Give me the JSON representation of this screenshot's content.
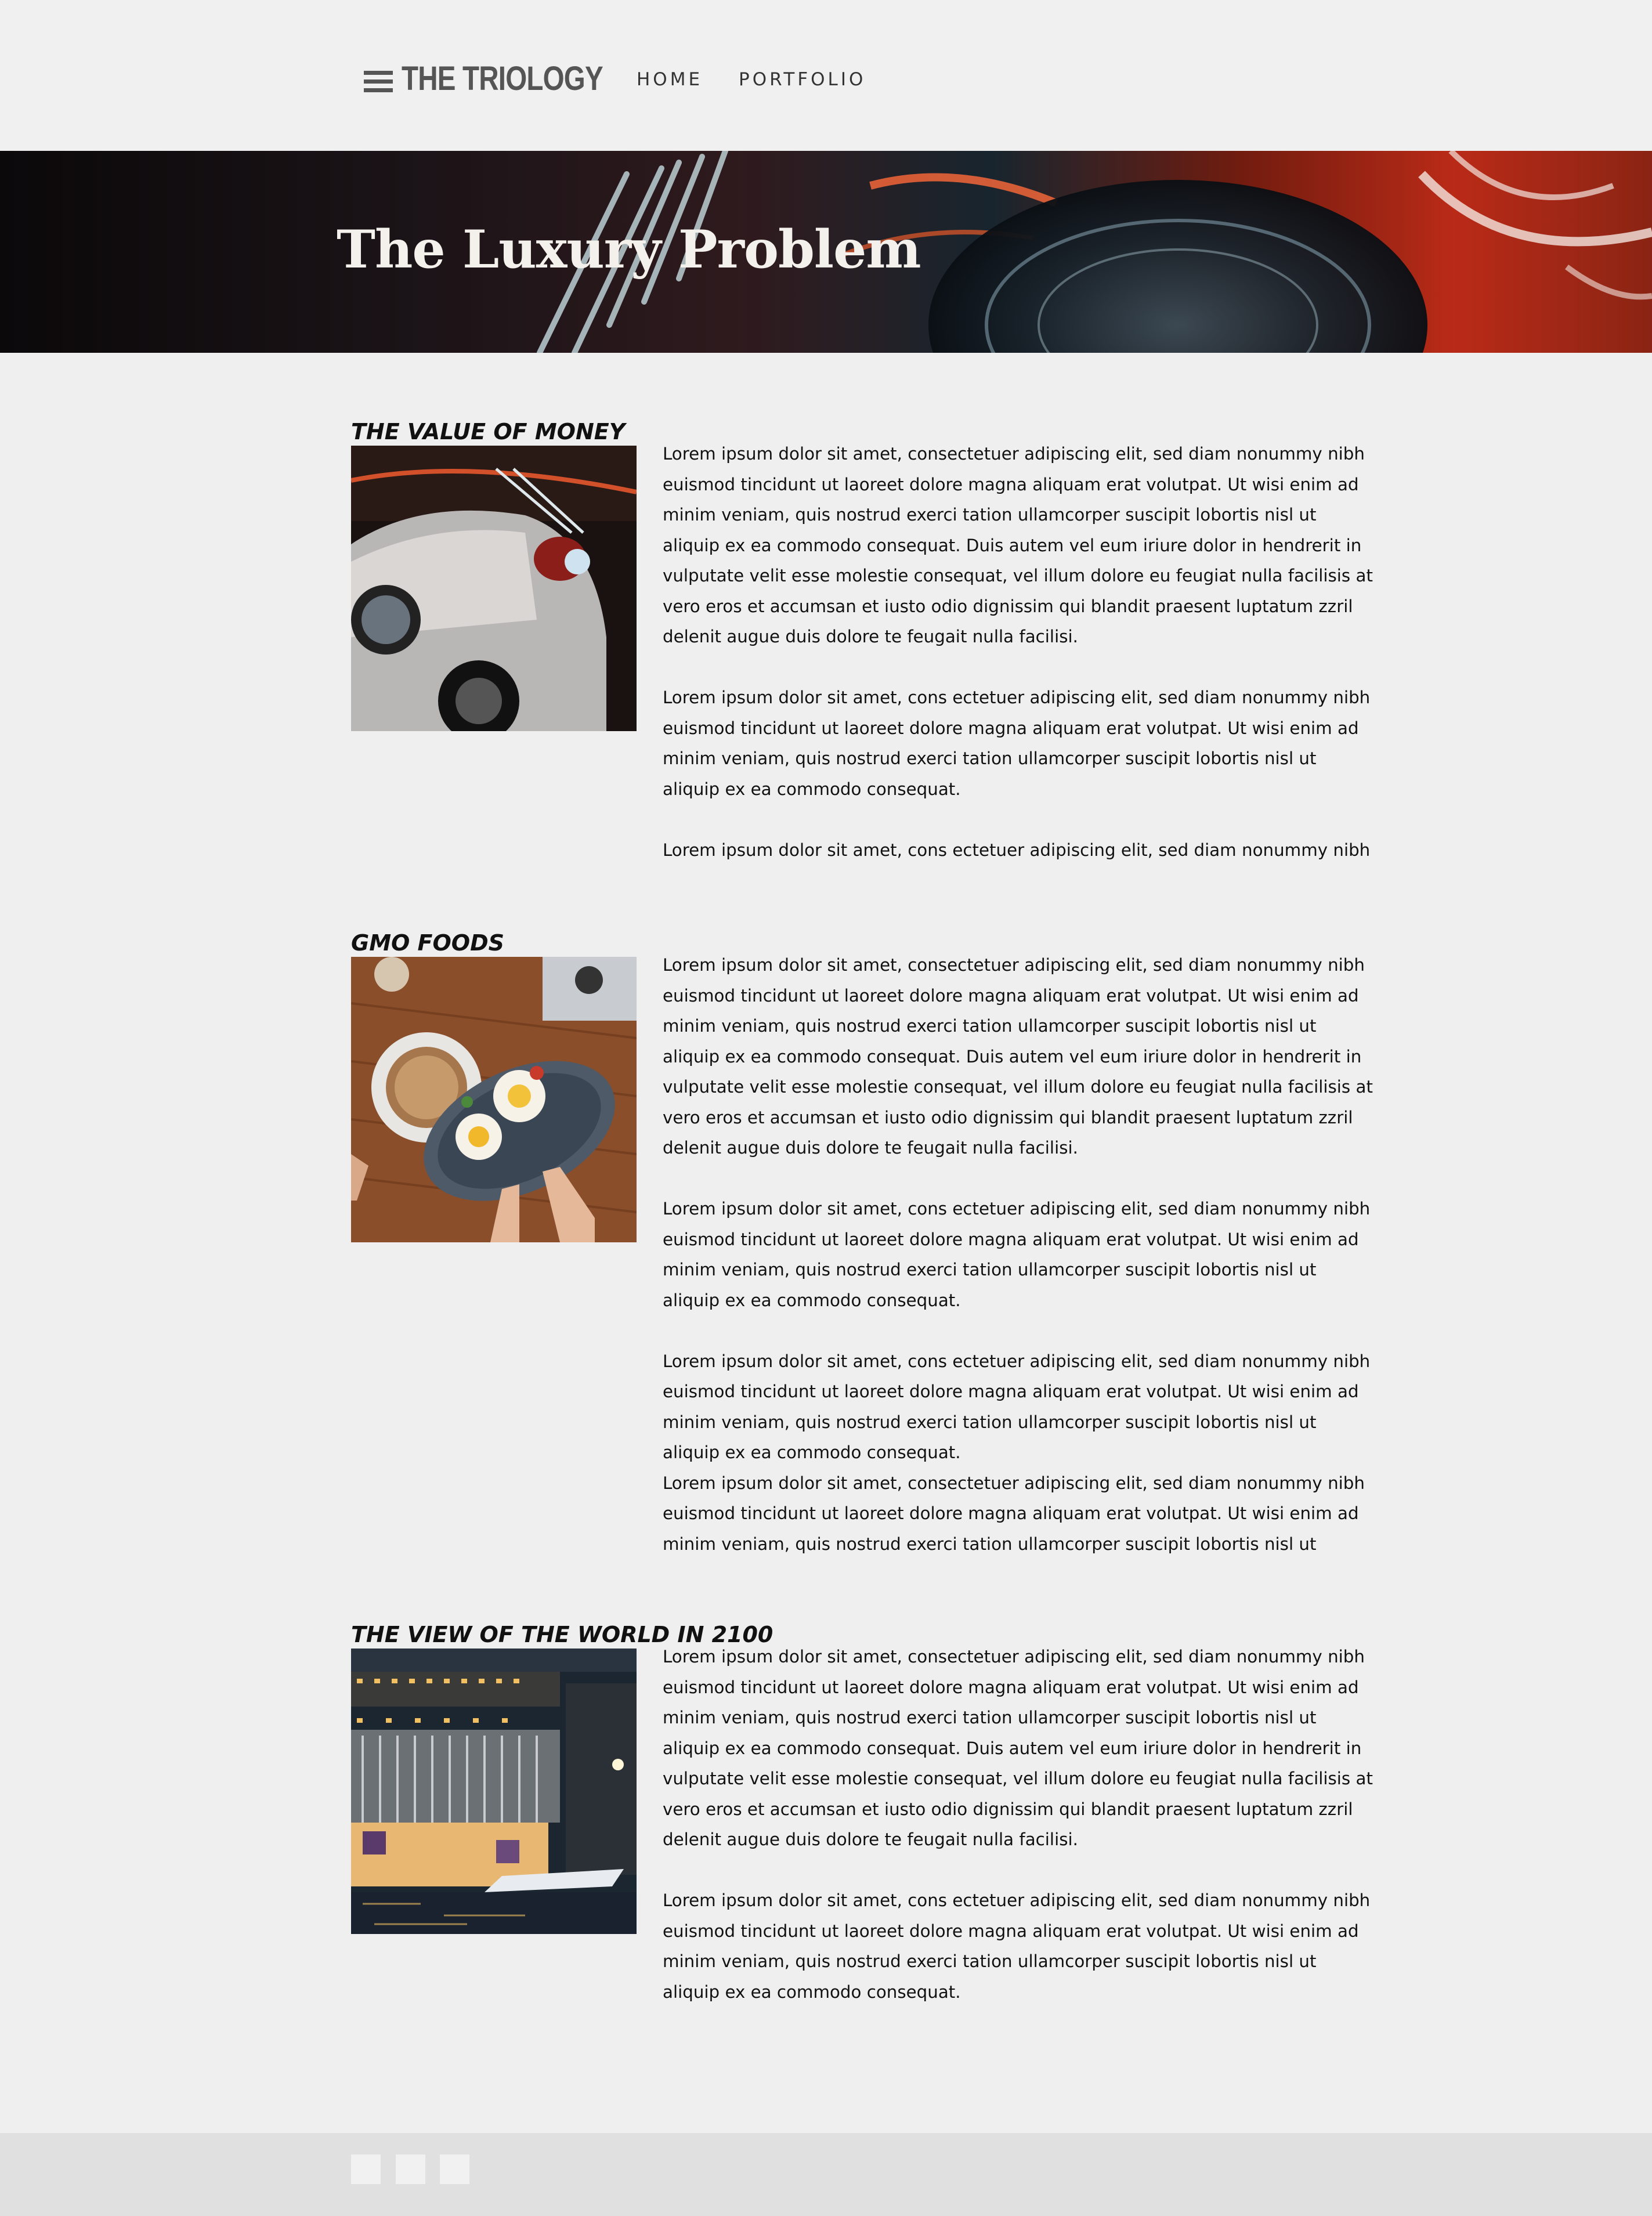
{
  "header": {
    "brand": "THE TRIOLOGY",
    "nav": [
      {
        "label": "HOME"
      },
      {
        "label": "PORTFOLIO"
      }
    ]
  },
  "hero": {
    "title": "The Luxury Problem"
  },
  "articles": [
    {
      "title": "THE VALUE OF MONEY",
      "image_icon": "car-photo",
      "lines": [
        "Lorem ipsum dolor sit amet, consectetuer adipiscing elit, sed diam nonummy nibh",
        "euismod tincidunt ut laoreet dolore magna aliquam erat volutpat. Ut wisi enim ad",
        "minim veniam, quis nostrud exerci tation ullamcorper suscipit lobortis nisl ut",
        "aliquip ex ea commodo consequat. Duis autem vel eum iriure dolor in hendrerit in",
        "vulputate velit esse molestie consequat, vel illum dolore eu feugiat nulla facilisis at",
        "vero eros et accumsan et iusto odio dignissim qui blandit praesent luptatum zzril",
        "delenit augue duis dolore te feugait nulla facilisi.",
        "",
        "Lorem ipsum dolor sit amet, cons ectetuer adipiscing elit, sed diam nonummy nibh",
        "euismod tincidunt ut laoreet dolore magna aliquam erat volutpat. Ut wisi enim ad",
        "minim veniam, quis nostrud exerci tation ullamcorper suscipit lobortis nisl ut",
        "aliquip ex ea commodo consequat.",
        "",
        "Lorem ipsum dolor sit amet, cons ectetuer adipiscing elit, sed diam nonummy nibh"
      ]
    },
    {
      "title": "GMO FOODS",
      "image_icon": "breakfast-photo",
      "lines": [
        "Lorem ipsum dolor sit amet, consectetuer adipiscing elit, sed diam nonummy nibh",
        "euismod tincidunt ut laoreet dolore magna aliquam erat volutpat. Ut wisi enim ad",
        "minim veniam, quis nostrud exerci tation ullamcorper suscipit lobortis nisl ut",
        "aliquip ex ea commodo consequat. Duis autem vel eum iriure dolor in hendrerit in",
        "vulputate velit esse molestie consequat, vel illum dolore eu feugiat nulla facilisis at",
        "vero eros et accumsan et iusto odio dignissim qui blandit praesent luptatum zzril",
        "delenit augue duis dolore te feugait nulla facilisi.",
        "",
        "Lorem ipsum dolor sit amet, cons ectetuer adipiscing elit, sed diam nonummy nibh",
        "euismod tincidunt ut laoreet dolore magna aliquam erat volutpat. Ut wisi enim ad",
        "minim veniam, quis nostrud exerci tation ullamcorper suscipit lobortis nisl ut",
        "aliquip ex ea commodo consequat.",
        "",
        "Lorem ipsum dolor sit amet, cons ectetuer adipiscing elit, sed diam nonummy nibh",
        "euismod tincidunt ut laoreet dolore magna aliquam erat volutpat. Ut wisi enim ad",
        "minim veniam, quis nostrud exerci tation ullamcorper suscipit lobortis nisl ut",
        "aliquip ex ea commodo consequat.",
        "Lorem ipsum dolor sit amet, consectetuer adipiscing elit, sed diam nonummy nibh",
        "euismod tincidunt ut laoreet dolore magna aliquam erat volutpat. Ut wisi enim ad",
        "minim veniam, quis nostrud exerci tation ullamcorper suscipit lobortis nisl ut"
      ]
    },
    {
      "title": "THE VIEW OF THE WORLD IN 2100",
      "image_icon": "city-night-photo",
      "lines": [
        "Lorem ipsum dolor sit amet, consectetuer adipiscing elit, sed diam nonummy nibh",
        "euismod tincidunt ut laoreet dolore magna aliquam erat volutpat. Ut wisi enim ad",
        "minim veniam, quis nostrud exerci tation ullamcorper suscipit lobortis nisl ut",
        "aliquip ex ea commodo consequat. Duis autem vel eum iriure dolor in hendrerit in",
        "vulputate velit esse molestie consequat, vel illum dolore eu feugiat nulla facilisis at",
        "vero eros et accumsan et iusto odio dignissim qui blandit praesent luptatum zzril",
        "delenit augue duis dolore te feugait nulla facilisi.",
        "",
        "Lorem ipsum dolor sit amet, cons ectetuer adipiscing elit, sed diam nonummy nibh",
        "euismod tincidunt ut laoreet dolore magna aliquam erat volutpat. Ut wisi enim ad",
        "minim veniam, quis nostrud exerci tation ullamcorper suscipit lobortis nisl ut",
        "aliquip ex ea commodo consequat."
      ]
    }
  ],
  "footer": {
    "social_icons": [
      "social-icon-1",
      "social-icon-2",
      "social-icon-3"
    ]
  },
  "colors": {
    "page_background": "#efefef",
    "footer_background": "#e0e0e0",
    "brand_text": "#555555",
    "body_text": "#111111"
  }
}
